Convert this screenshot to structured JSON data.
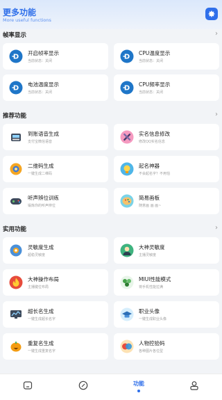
{
  "header": {
    "title": "更多功能",
    "subtitle": "More useful functions"
  },
  "sections": {
    "fps": {
      "title": "帧率显示",
      "arrow": "›"
    },
    "recommend": {
      "title": "推荐功能",
      "arrow": "›"
    },
    "practical": {
      "title": "实用功能",
      "arrow": "›"
    }
  },
  "fps_cards": [
    {
      "title": "开启帧率显示",
      "desc": "当前状态：关闭"
    },
    {
      "title": "CPU温度显示",
      "desc": "当前状态：关闭"
    },
    {
      "title": "电池温度显示",
      "desc": "当前状态：关闭"
    },
    {
      "title": "CPU频率显示",
      "desc": "当前状态：关闭"
    }
  ],
  "recommend_cards": [
    {
      "title": "到账语音生成",
      "desc": "支付宝微信语音"
    },
    {
      "title": "实名信息修改",
      "desc": "修改QQ实名信息"
    },
    {
      "title": "二维码生成",
      "desc": "一键生成二维码"
    },
    {
      "title": "起名神器",
      "desc": "不会起名字？不用怕"
    },
    {
      "title": "听声辨位训练",
      "desc": "锻炼你的听声辨位"
    },
    {
      "title": "简易画板",
      "desc": "随意画 画 画~"
    }
  ],
  "practical_cards": [
    {
      "title": "灵敏度生成",
      "desc": "超稳灵敏度"
    },
    {
      "title": "大神灵敏度",
      "desc": "主播灵敏度"
    },
    {
      "title": "大神操作布局",
      "desc": "主播键位布局"
    },
    {
      "title": "MIUI性能模式",
      "desc": "将手机性能拉满"
    },
    {
      "title": "超长名生成",
      "desc": "一键生成超长名字"
    },
    {
      "title": "职业头像",
      "desc": "一键生成职业头像"
    },
    {
      "title": "重复名生成",
      "desc": "一键生成重复名字"
    },
    {
      "title": "人物控验码",
      "desc": "各种图片各位型"
    }
  ],
  "nav": {
    "active_label": "功能"
  },
  "colors": {
    "accent": "#2f6fea",
    "background": "#f2f4f7",
    "card": "#ffffff"
  }
}
